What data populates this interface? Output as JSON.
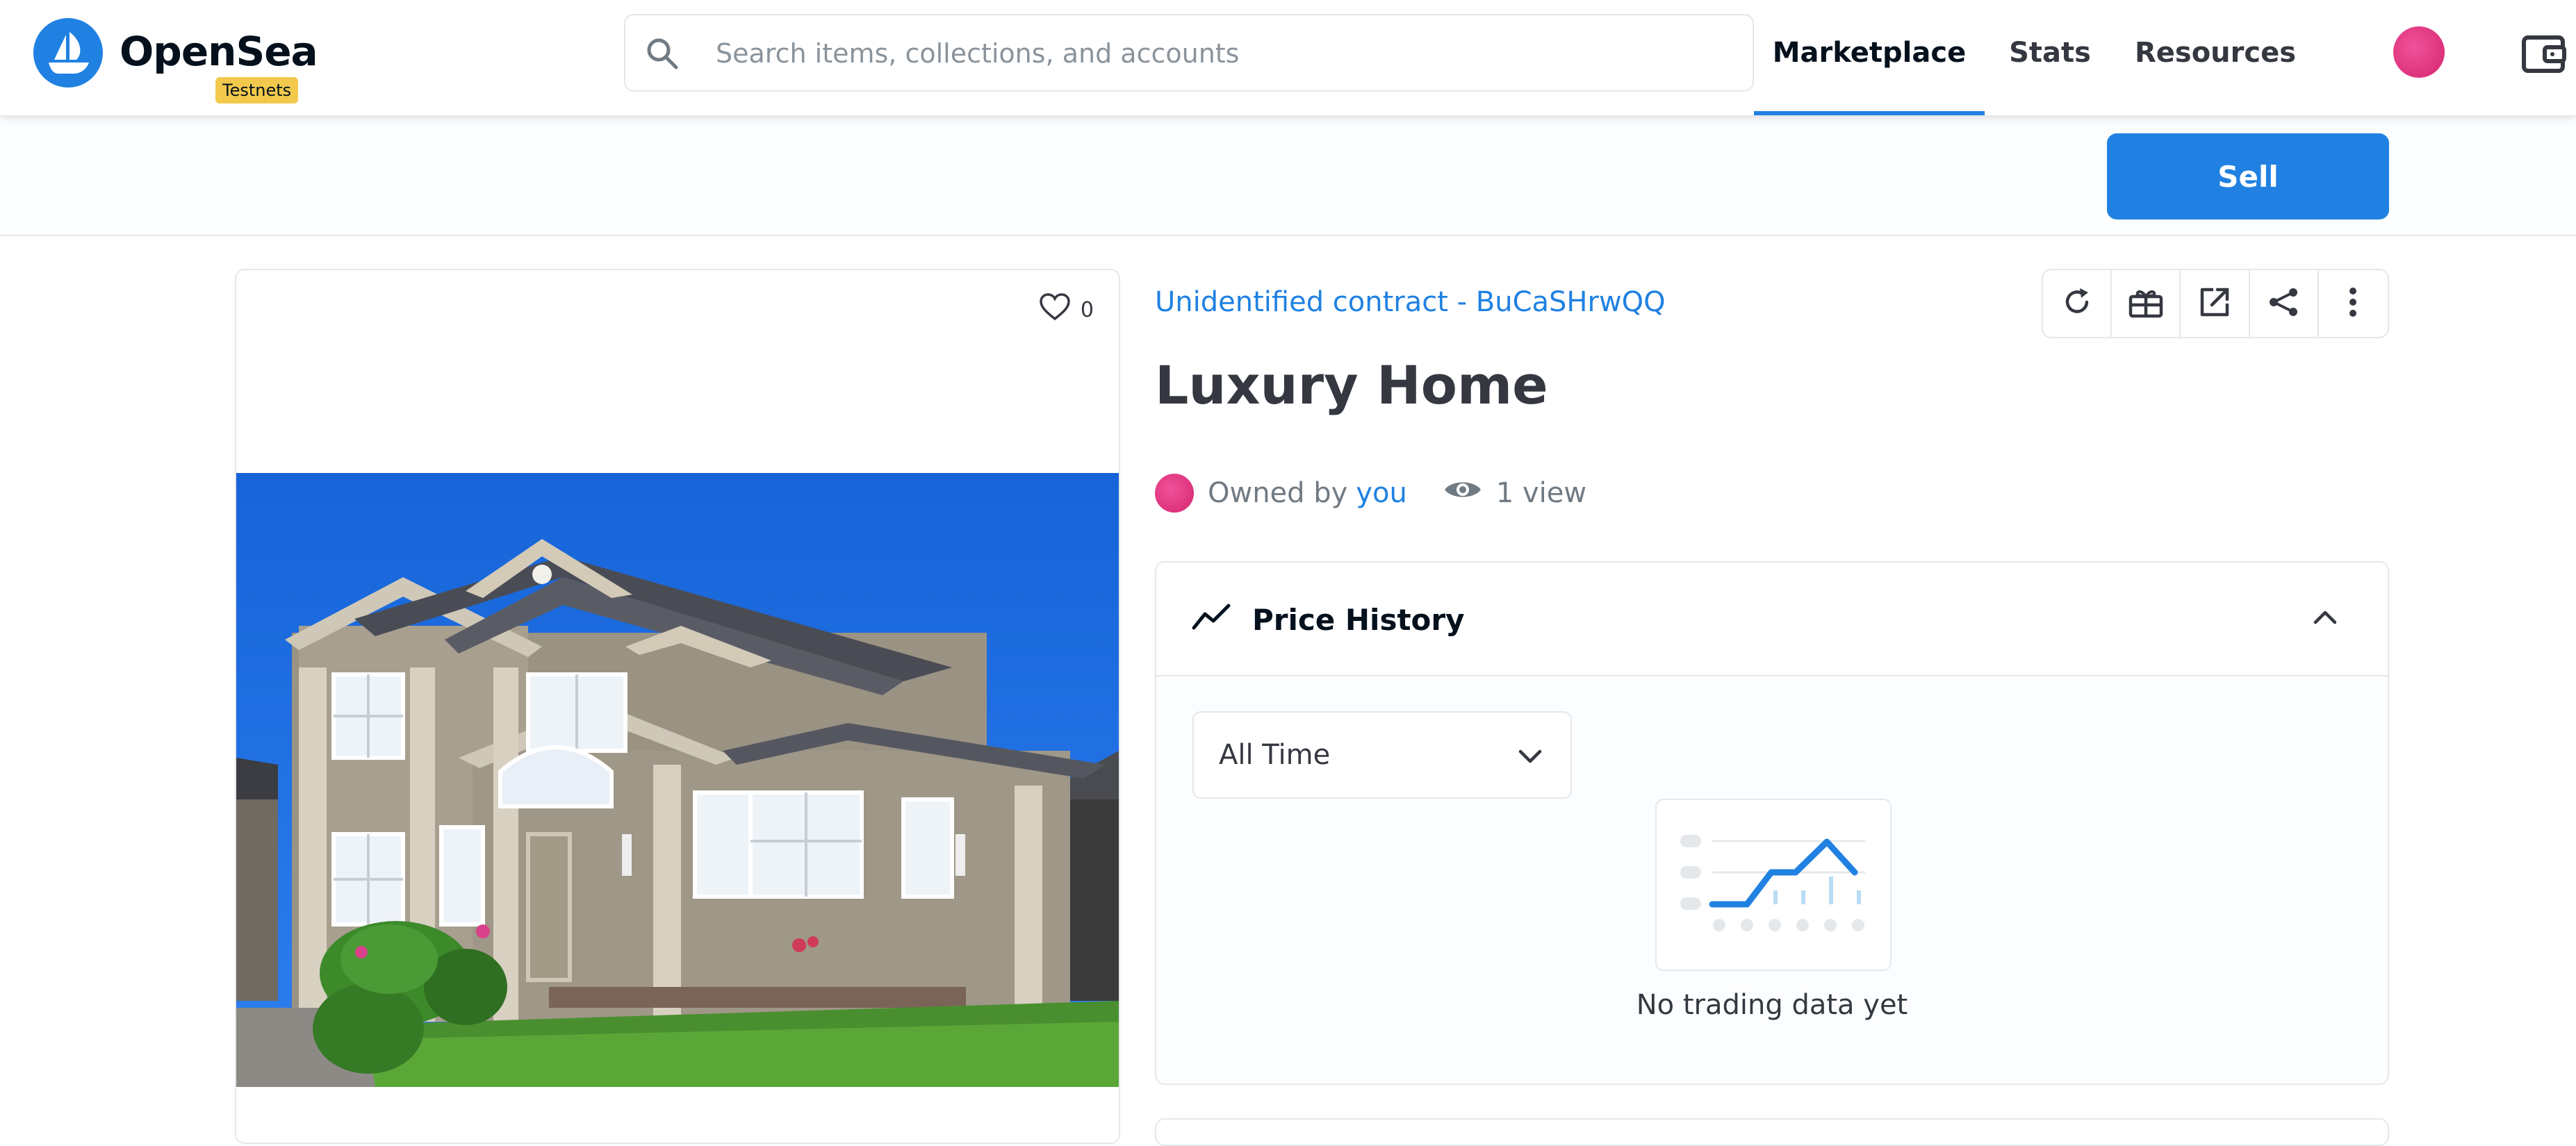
{
  "header": {
    "brand": "OpenSea",
    "badge": "Testnets",
    "search_placeholder": "Search items, collections, and accounts",
    "nav": [
      {
        "label": "Marketplace",
        "active": true
      },
      {
        "label": "Stats",
        "active": false
      },
      {
        "label": "Resources",
        "active": false
      }
    ]
  },
  "subbar": {
    "sell_label": "Sell"
  },
  "asset": {
    "likes": "0",
    "contract": "Unidentified contract - BuCaSHrwQQ",
    "title": "Luxury Home",
    "owned_by": "Owned by",
    "owner": "you",
    "views": "1 view"
  },
  "price_history": {
    "title": "Price History",
    "range": "All Time",
    "empty_text": "No trading data yet"
  },
  "colors": {
    "accent": "#2081e2",
    "badge": "#f2c94c",
    "avatar": "#e0307f"
  },
  "icons": {
    "actions": [
      "refresh-icon",
      "gift-icon",
      "external-link-icon",
      "share-icon",
      "more-icon"
    ]
  }
}
